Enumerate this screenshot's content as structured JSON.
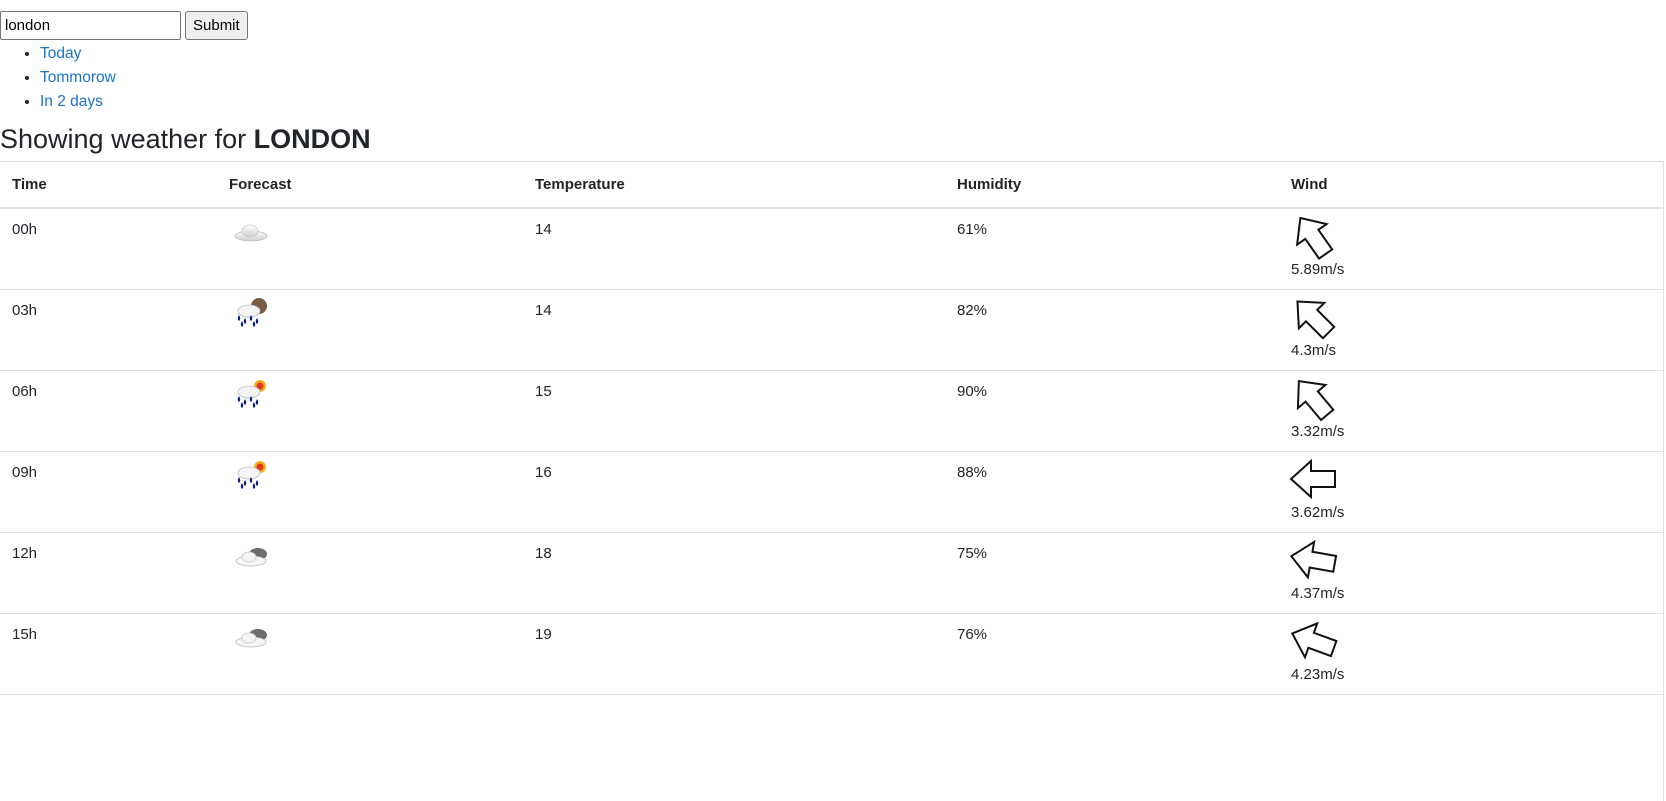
{
  "search": {
    "value": "london",
    "submit_label": "Submit"
  },
  "nav": {
    "items": [
      {
        "label": "Today"
      },
      {
        "label": "Tommorow"
      },
      {
        "label": "In 2 days"
      }
    ]
  },
  "heading": {
    "prefix": "Showing weather for",
    "city": "LONDON"
  },
  "table": {
    "headers": {
      "time": "Time",
      "forecast": "Forecast",
      "temperature": "Temperature",
      "humidity": "Humidity",
      "wind": "Wind"
    },
    "rows": [
      {
        "time": "00h",
        "forecast_icon": "cloudy-icon",
        "temperature": "14",
        "humidity": "61%",
        "wind_direction": "arrow-down-left",
        "wind_deg": 35,
        "wind_speed": "5.89m/s"
      },
      {
        "time": "03h",
        "forecast_icon": "rain-night-icon",
        "temperature": "14",
        "humidity": "82%",
        "wind_direction": "arrow-down-left",
        "wind_deg": 45,
        "wind_speed": "4.3m/s"
      },
      {
        "time": "06h",
        "forecast_icon": "rain-sun-icon",
        "temperature": "15",
        "humidity": "90%",
        "wind_direction": "arrow-down-left",
        "wind_deg": 40,
        "wind_speed": "3.32m/s"
      },
      {
        "time": "09h",
        "forecast_icon": "rain-sun-icon",
        "temperature": "16",
        "humidity": "88%",
        "wind_direction": "arrow-left",
        "wind_deg": 90,
        "wind_speed": "3.62m/s"
      },
      {
        "time": "12h",
        "forecast_icon": "broken-clouds-icon",
        "temperature": "18",
        "humidity": "75%",
        "wind_direction": "arrow-left",
        "wind_deg": 80,
        "wind_speed": "4.37m/s"
      },
      {
        "time": "15h",
        "forecast_icon": "broken-clouds-icon",
        "temperature": "19",
        "humidity": "76%",
        "wind_direction": "arrow-left",
        "wind_deg": 70,
        "wind_speed": "4.23m/s"
      }
    ]
  },
  "colors": {
    "link": "#1a73c9",
    "text": "#212529",
    "border": "#dee2e6",
    "rain": "#0b1f8c",
    "sun": "#f2b01e",
    "sun_core": "#e0391a"
  }
}
